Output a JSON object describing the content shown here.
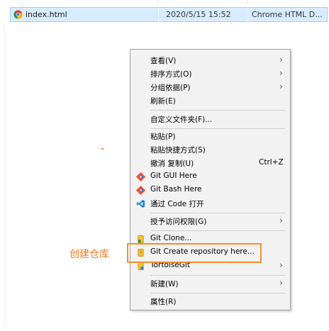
{
  "file": {
    "name": "index.html",
    "modified": "2020/5/15 15:52",
    "type": "Chrome HTML D..."
  },
  "context_menu": {
    "items": [
      {
        "label": "查看(V)",
        "submenu": true
      },
      {
        "label": "排序方式(O)",
        "submenu": true
      },
      {
        "label": "分组依据(P)",
        "submenu": true
      },
      {
        "label": "刷新(E)"
      },
      {
        "label": "自定义文件夹(F)..."
      },
      {
        "label": "粘贴(P)"
      },
      {
        "label": "粘贴快捷方式(S)"
      },
      {
        "label": "撤消 复制(U)",
        "shortcut": "Ctrl+Z"
      },
      {
        "label": "Git GUI Here",
        "icon": "git-icon"
      },
      {
        "label": "Git Bash Here",
        "icon": "git-icon"
      },
      {
        "label": "通过 Code 打开",
        "icon": "vscode-icon"
      },
      {
        "label": "授予访问权限(G)",
        "submenu": true
      },
      {
        "label": "Git Clone...",
        "icon": "tortoisegit-icon"
      },
      {
        "label": "Git Create repository here...",
        "icon": "tortoisegit-icon"
      },
      {
        "label": "TortoiseGit",
        "icon": "tortoisegit-icon",
        "submenu": true
      },
      {
        "label": "新建(W)",
        "submenu": true
      },
      {
        "label": "属性(R)"
      }
    ]
  },
  "annotation": {
    "text": "创建仓库",
    "color": "#f07a23"
  }
}
